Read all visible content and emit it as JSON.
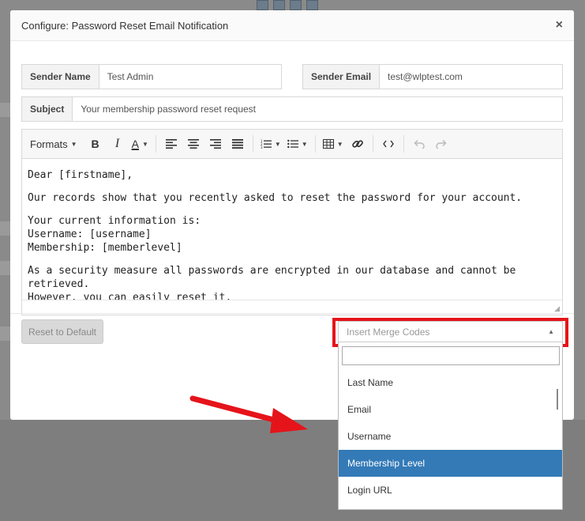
{
  "modal": {
    "title": "Configure: Password Reset Email Notification",
    "close_glyph": "×"
  },
  "fields": {
    "sender_name": {
      "label": "Sender Name",
      "value": "Test Admin"
    },
    "sender_email": {
      "label": "Sender Email",
      "value": "test@wlptest.com"
    },
    "subject": {
      "label": "Subject",
      "value": "Your membership password reset request"
    }
  },
  "toolbar": {
    "formats_label": "Formats",
    "bold": "B",
    "italic": "I",
    "font_color": "A"
  },
  "editor": {
    "line1": "Dear [firstname],",
    "line2": "Our records show that you recently asked to reset the password for your account.",
    "line3a": "Your current information is:",
    "line3b": "Username: [username]",
    "line3c": "Membership: [memberlevel]",
    "line4a": "As a security measure all passwords are encrypted in our database and cannot be retrieved.",
    "line4b": "However, you can easily reset it."
  },
  "footer": {
    "reset_label": "Reset to Default"
  },
  "merge_codes": {
    "placeholder": "Insert Merge Codes",
    "options": [
      "Last Name",
      "Email",
      "Username",
      "Membership Level",
      "Login URL"
    ],
    "highlighted": "Membership Level"
  },
  "colors": {
    "highlight_border": "#e5141a",
    "option_active": "#337ab7",
    "arrow": "#e5141a"
  },
  "icons": [
    "bold-icon",
    "italic-icon",
    "font-color-icon",
    "align-left-icon",
    "align-center-icon",
    "align-right-icon",
    "align-justify-icon",
    "numbered-list-icon",
    "bullet-list-icon",
    "table-icon",
    "link-icon",
    "code-icon",
    "undo-icon",
    "redo-icon"
  ]
}
